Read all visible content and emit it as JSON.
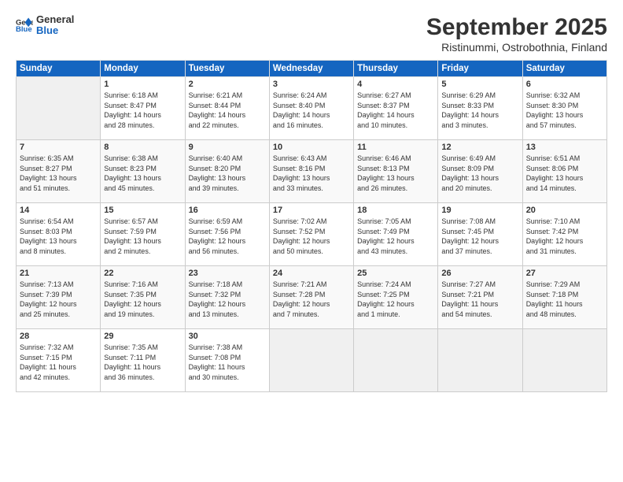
{
  "header": {
    "logo_line1": "General",
    "logo_line2": "Blue",
    "month_title": "September 2025",
    "location": "Ristinummi, Ostrobothnia, Finland"
  },
  "days_of_week": [
    "Sunday",
    "Monday",
    "Tuesday",
    "Wednesday",
    "Thursday",
    "Friday",
    "Saturday"
  ],
  "weeks": [
    [
      {
        "day": "",
        "content": ""
      },
      {
        "day": "1",
        "content": "Sunrise: 6:18 AM\nSunset: 8:47 PM\nDaylight: 14 hours\nand 28 minutes."
      },
      {
        "day": "2",
        "content": "Sunrise: 6:21 AM\nSunset: 8:44 PM\nDaylight: 14 hours\nand 22 minutes."
      },
      {
        "day": "3",
        "content": "Sunrise: 6:24 AM\nSunset: 8:40 PM\nDaylight: 14 hours\nand 16 minutes."
      },
      {
        "day": "4",
        "content": "Sunrise: 6:27 AM\nSunset: 8:37 PM\nDaylight: 14 hours\nand 10 minutes."
      },
      {
        "day": "5",
        "content": "Sunrise: 6:29 AM\nSunset: 8:33 PM\nDaylight: 14 hours\nand 3 minutes."
      },
      {
        "day": "6",
        "content": "Sunrise: 6:32 AM\nSunset: 8:30 PM\nDaylight: 13 hours\nand 57 minutes."
      }
    ],
    [
      {
        "day": "7",
        "content": "Sunrise: 6:35 AM\nSunset: 8:27 PM\nDaylight: 13 hours\nand 51 minutes."
      },
      {
        "day": "8",
        "content": "Sunrise: 6:38 AM\nSunset: 8:23 PM\nDaylight: 13 hours\nand 45 minutes."
      },
      {
        "day": "9",
        "content": "Sunrise: 6:40 AM\nSunset: 8:20 PM\nDaylight: 13 hours\nand 39 minutes."
      },
      {
        "day": "10",
        "content": "Sunrise: 6:43 AM\nSunset: 8:16 PM\nDaylight: 13 hours\nand 33 minutes."
      },
      {
        "day": "11",
        "content": "Sunrise: 6:46 AM\nSunset: 8:13 PM\nDaylight: 13 hours\nand 26 minutes."
      },
      {
        "day": "12",
        "content": "Sunrise: 6:49 AM\nSunset: 8:09 PM\nDaylight: 13 hours\nand 20 minutes."
      },
      {
        "day": "13",
        "content": "Sunrise: 6:51 AM\nSunset: 8:06 PM\nDaylight: 13 hours\nand 14 minutes."
      }
    ],
    [
      {
        "day": "14",
        "content": "Sunrise: 6:54 AM\nSunset: 8:03 PM\nDaylight: 13 hours\nand 8 minutes."
      },
      {
        "day": "15",
        "content": "Sunrise: 6:57 AM\nSunset: 7:59 PM\nDaylight: 13 hours\nand 2 minutes."
      },
      {
        "day": "16",
        "content": "Sunrise: 6:59 AM\nSunset: 7:56 PM\nDaylight: 12 hours\nand 56 minutes."
      },
      {
        "day": "17",
        "content": "Sunrise: 7:02 AM\nSunset: 7:52 PM\nDaylight: 12 hours\nand 50 minutes."
      },
      {
        "day": "18",
        "content": "Sunrise: 7:05 AM\nSunset: 7:49 PM\nDaylight: 12 hours\nand 43 minutes."
      },
      {
        "day": "19",
        "content": "Sunrise: 7:08 AM\nSunset: 7:45 PM\nDaylight: 12 hours\nand 37 minutes."
      },
      {
        "day": "20",
        "content": "Sunrise: 7:10 AM\nSunset: 7:42 PM\nDaylight: 12 hours\nand 31 minutes."
      }
    ],
    [
      {
        "day": "21",
        "content": "Sunrise: 7:13 AM\nSunset: 7:39 PM\nDaylight: 12 hours\nand 25 minutes."
      },
      {
        "day": "22",
        "content": "Sunrise: 7:16 AM\nSunset: 7:35 PM\nDaylight: 12 hours\nand 19 minutes."
      },
      {
        "day": "23",
        "content": "Sunrise: 7:18 AM\nSunset: 7:32 PM\nDaylight: 12 hours\nand 13 minutes."
      },
      {
        "day": "24",
        "content": "Sunrise: 7:21 AM\nSunset: 7:28 PM\nDaylight: 12 hours\nand 7 minutes."
      },
      {
        "day": "25",
        "content": "Sunrise: 7:24 AM\nSunset: 7:25 PM\nDaylight: 12 hours\nand 1 minute."
      },
      {
        "day": "26",
        "content": "Sunrise: 7:27 AM\nSunset: 7:21 PM\nDaylight: 11 hours\nand 54 minutes."
      },
      {
        "day": "27",
        "content": "Sunrise: 7:29 AM\nSunset: 7:18 PM\nDaylight: 11 hours\nand 48 minutes."
      }
    ],
    [
      {
        "day": "28",
        "content": "Sunrise: 7:32 AM\nSunset: 7:15 PM\nDaylight: 11 hours\nand 42 minutes."
      },
      {
        "day": "29",
        "content": "Sunrise: 7:35 AM\nSunset: 7:11 PM\nDaylight: 11 hours\nand 36 minutes."
      },
      {
        "day": "30",
        "content": "Sunrise: 7:38 AM\nSunset: 7:08 PM\nDaylight: 11 hours\nand 30 minutes."
      },
      {
        "day": "",
        "content": ""
      },
      {
        "day": "",
        "content": ""
      },
      {
        "day": "",
        "content": ""
      },
      {
        "day": "",
        "content": ""
      }
    ]
  ]
}
